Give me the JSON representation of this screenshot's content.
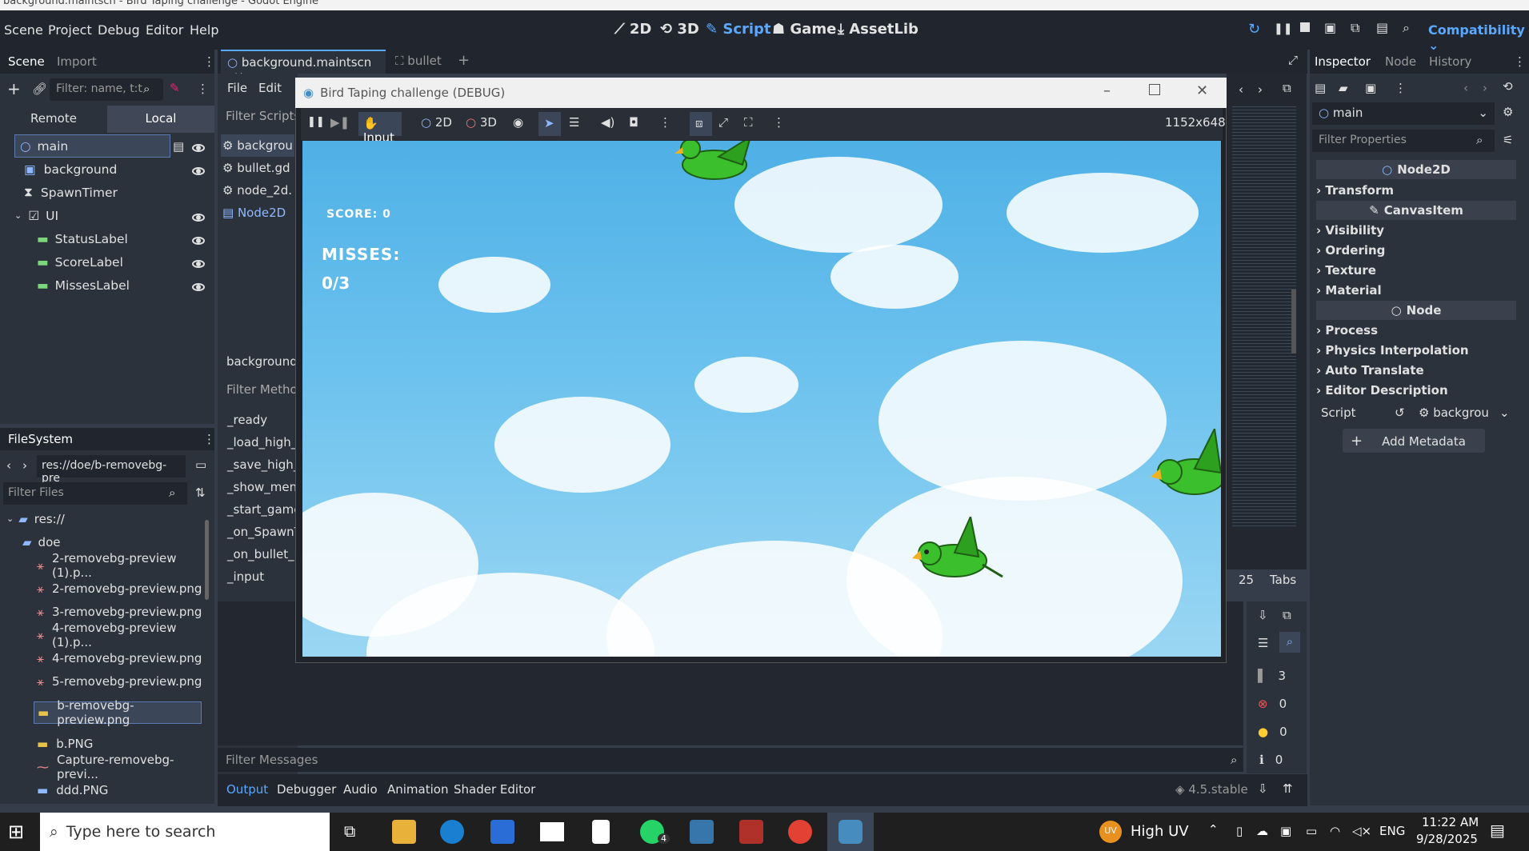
{
  "window_title": "background.maintscn - Bird Taping challenge - Godot Engine",
  "menu": [
    "Scene",
    "Project",
    "Debug",
    "Editor",
    "Help"
  ],
  "workspaces": {
    "w2d": "2D",
    "w3d": "3D",
    "script": "Script",
    "game": "Game",
    "assetlib": "AssetLib"
  },
  "renderer": "Compatibility",
  "scene_dock": {
    "tab_scene": "Scene",
    "tab_import": "Import",
    "filter_placeholder": "Filter: name, t:t",
    "remote": "Remote",
    "local": "Local",
    "nodes": [
      {
        "name": "main"
      },
      {
        "name": "background"
      },
      {
        "name": "SpawnTimer"
      },
      {
        "name": "UI"
      },
      {
        "name": "StatusLabel"
      },
      {
        "name": "ScoreLabel"
      },
      {
        "name": "MissesLabel"
      }
    ]
  },
  "filesystem": {
    "title": "FileSystem",
    "path": "res://doe/b-removebg-pre",
    "filter_placeholder": "Filter Files",
    "items": [
      "res://",
      "doe",
      "2-removebg-preview (1).p...",
      "2-removebg-preview.png",
      "3-removebg-preview.png",
      "4-removebg-preview (1).p...",
      "4-removebg-preview.png",
      "5-removebg-preview.png",
      "b-removebg-preview.png",
      "b.PNG",
      "Capture-removebg-previ...",
      "ddd.PNG"
    ]
  },
  "editor_tabs": {
    "active": "background.maintscn",
    "other": "bullet"
  },
  "script_panel": {
    "file": "File",
    "edit": "Edit",
    "filter_scripts": "Filter Scripts",
    "scripts": [
      "backgrou",
      "bullet.gd",
      "node_2d.",
      "Node2D"
    ],
    "current": "background.r",
    "filter_methods": "Filter Methoo",
    "methods": [
      "_ready",
      "_load_high_s",
      "_save_high_s",
      "_show_menu",
      "_start_game",
      "_on_SpawnTi",
      "_on_bullet_m",
      "_input"
    ]
  },
  "game_window": {
    "title": "Bird Taping challenge (DEBUG)",
    "input": "Input",
    "m2d": "2D",
    "m3d": "3D",
    "resolution": "1152x648",
    "score": "SCORE: 0",
    "misses_label": "MISSES:",
    "misses_value": "0/3"
  },
  "code_status": {
    "line": "25",
    "tabs": "Tabs"
  },
  "debug_counts": {
    "c1": "3",
    "errors": "0",
    "warnings": "0",
    "info": "0"
  },
  "output": {
    "filter_placeholder": "Filter Messages",
    "version": "4.5.stable",
    "tabs": [
      "Output",
      "Debugger",
      "Audio",
      "Animation",
      "Shader Editor"
    ]
  },
  "inspector": {
    "tabs": [
      "Inspector",
      "Node",
      "History"
    ],
    "object": "main",
    "filter_placeholder": "Filter Properties",
    "node2d": "Node2D",
    "transform": "Transform",
    "canvasitem": "CanvasItem",
    "visibility": "Visibility",
    "ordering": "Ordering",
    "texture": "Texture",
    "material": "Material",
    "node": "Node",
    "process": "Process",
    "physics": "Physics Interpolation",
    "autotranslate": "Auto Translate",
    "editordesc": "Editor Description",
    "script_label": "Script",
    "script_value": "backgrou",
    "add_metadata": "Add Metadata"
  },
  "taskbar": {
    "search_placeholder": "Type here to search",
    "weather": "High UV",
    "lang": "ENG",
    "time": "11:22 AM",
    "date": "9/28/2025",
    "badge": "4"
  }
}
